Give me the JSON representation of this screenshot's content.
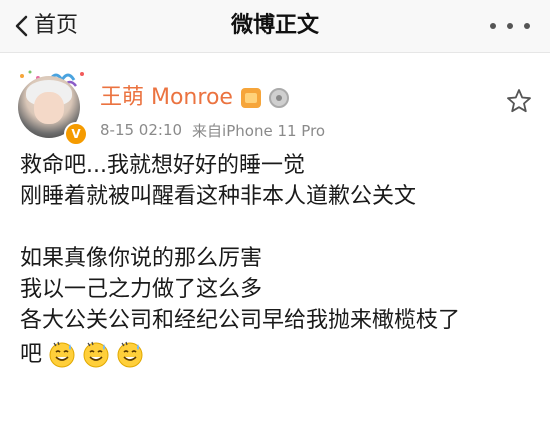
{
  "nav": {
    "back_label": "首页",
    "title": "微博正文"
  },
  "post": {
    "username": "王萌 Monroe",
    "time": "8-15 02:10",
    "source": "来自iPhone 11 Pro",
    "lines": [
      "救命吧...我就想好好的睡一觉",
      "刚睡着就被叫醒看这种非本人道歉公关文",
      "",
      "如果真像你说的那么厉害",
      "我以一己之力做了这么多",
      "各大公关公司和经纪公司早给我抛来橄榄枝了"
    ],
    "last_line_text": "吧",
    "emojis": [
      "sweat-smile-emoji",
      "sweat-smile-emoji",
      "sweat-smile-emoji"
    ]
  },
  "colors": {
    "username": "#eb7340",
    "meta": "#8a8a8a",
    "verified": "#f59b00"
  }
}
